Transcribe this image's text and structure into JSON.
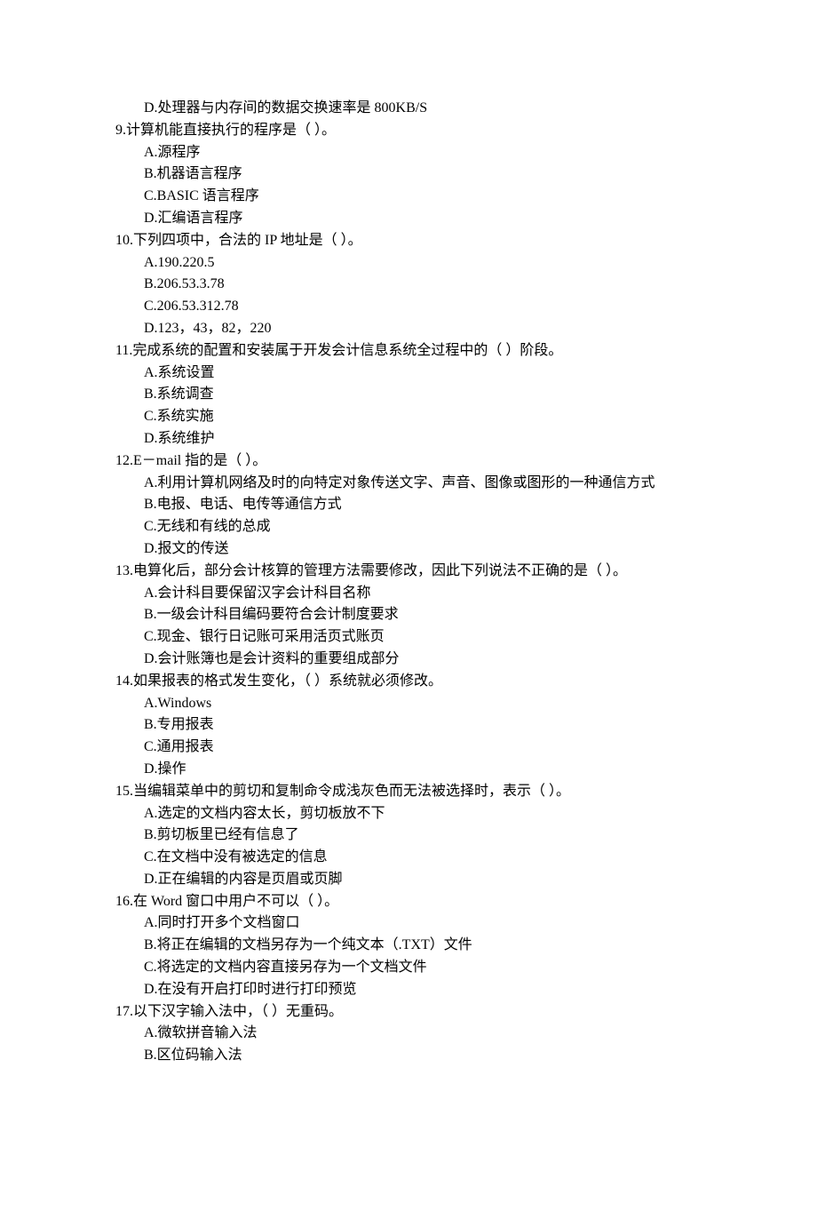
{
  "lines": [
    {
      "type": "option",
      "text": "D.处理器与内存间的数据交换速率是 800KB/S"
    },
    {
      "type": "question",
      "text": "9.计算机能直接执行的程序是（ ）。"
    },
    {
      "type": "option",
      "text": "A.源程序"
    },
    {
      "type": "option",
      "text": "B.机器语言程序"
    },
    {
      "type": "option",
      "text": "C.BASIC 语言程序"
    },
    {
      "type": "option",
      "text": "D.汇编语言程序"
    },
    {
      "type": "question",
      "text": "10.下列四项中，合法的 IP 地址是（ ）。"
    },
    {
      "type": "option",
      "text": "A.190.220.5"
    },
    {
      "type": "option",
      "text": "B.206.53.3.78"
    },
    {
      "type": "option",
      "text": "C.206.53.312.78"
    },
    {
      "type": "option",
      "text": "D.123，43，82，220"
    },
    {
      "type": "question",
      "text": "11.完成系统的配置和安装属于开发会计信息系统全过程中的（ ）阶段。"
    },
    {
      "type": "option",
      "text": "A.系统设置"
    },
    {
      "type": "option",
      "text": "B.系统调查"
    },
    {
      "type": "option",
      "text": "C.系统实施"
    },
    {
      "type": "option",
      "text": "D.系统维护"
    },
    {
      "type": "question",
      "text": "12.E－mail 指的是（ ）。"
    },
    {
      "type": "option",
      "text": "A.利用计算机网络及时的向特定对象传送文字、声音、图像或图形的一种通信方式"
    },
    {
      "type": "option",
      "text": "B.电报、电话、电传等通信方式"
    },
    {
      "type": "option",
      "text": "C.无线和有线的总成"
    },
    {
      "type": "option",
      "text": "D.报文的传送"
    },
    {
      "type": "question",
      "text": "13.电算化后，部分会计核算的管理方法需要修改，因此下列说法不正确的是（ ）。"
    },
    {
      "type": "option",
      "text": "A.会计科目要保留汉字会计科目名称"
    },
    {
      "type": "option",
      "text": "B.一级会计科目编码要符合会计制度要求"
    },
    {
      "type": "option",
      "text": "C.现金、银行日记账可采用活页式账页"
    },
    {
      "type": "option",
      "text": "D.会计账簿也是会计资料的重要组成部分"
    },
    {
      "type": "question",
      "text": "14.如果报表的格式发生变化，（ ）系统就必须修改。"
    },
    {
      "type": "option",
      "text": "A.Windows"
    },
    {
      "type": "option",
      "text": "B.专用报表"
    },
    {
      "type": "option",
      "text": "C.通用报表"
    },
    {
      "type": "option",
      "text": "D.操作"
    },
    {
      "type": "question",
      "text": "15.当编辑菜单中的剪切和复制命令成浅灰色而无法被选择时，表示（ ）。"
    },
    {
      "type": "option",
      "text": "A.选定的文档内容太长，剪切板放不下"
    },
    {
      "type": "option",
      "text": "B.剪切板里已经有信息了"
    },
    {
      "type": "option",
      "text": "C.在文档中没有被选定的信息"
    },
    {
      "type": "option",
      "text": "D.正在编辑的内容是页眉或页脚"
    },
    {
      "type": "question",
      "text": "16.在 Word 窗口中用户不可以（ ）。"
    },
    {
      "type": "option",
      "text": "A.同时打开多个文档窗口"
    },
    {
      "type": "option",
      "text": "B.将正在编辑的文档另存为一个纯文本（.TXT）文件"
    },
    {
      "type": "option",
      "text": "C.将选定的文档内容直接另存为一个文档文件"
    },
    {
      "type": "option",
      "text": "D.在没有开启打印时进行打印预览"
    },
    {
      "type": "question",
      "text": "17.以下汉字输入法中，（ ）无重码。"
    },
    {
      "type": "option",
      "text": "A.微软拼音输入法"
    },
    {
      "type": "option",
      "text": "B.区位码输入法"
    }
  ]
}
